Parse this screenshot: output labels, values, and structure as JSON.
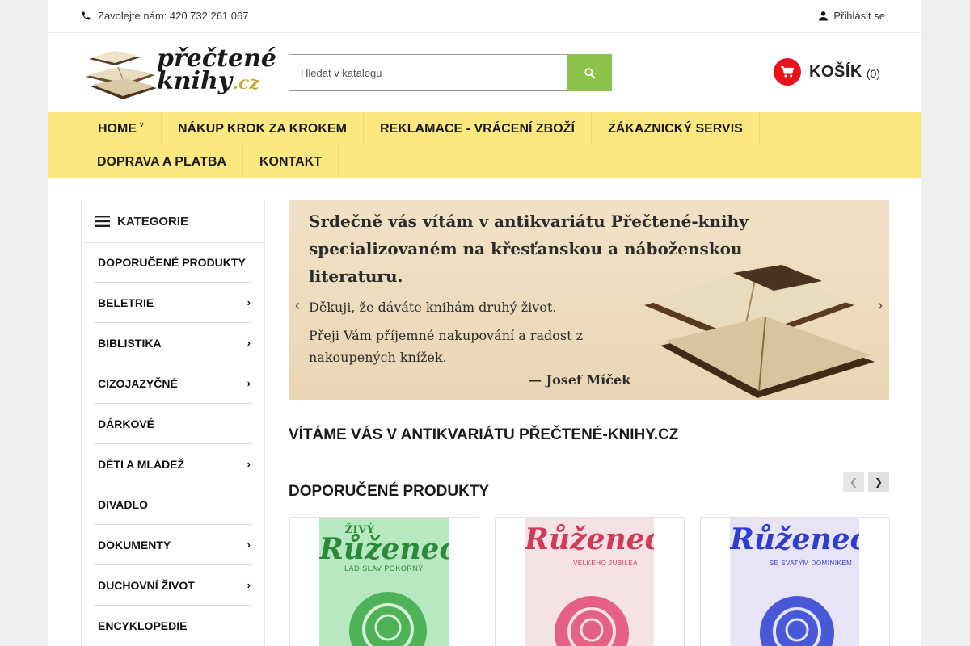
{
  "topbar": {
    "phone_text": "Zavolejte nám: 420 732 261 067",
    "login_text": "Přihlásit se"
  },
  "logo": {
    "line1": "přečtené",
    "line2": "knihy",
    "line3": ".cz"
  },
  "search": {
    "placeholder": "Hledat v katalogu"
  },
  "cart": {
    "label": "KOŠÍK",
    "count": "(0)"
  },
  "nav": {
    "items": [
      {
        "label": "HOME"
      },
      {
        "label": "NÁKUP KROK ZA KROKEM"
      },
      {
        "label": "REKLAMACE - VRÁCENÍ ZBOŽÍ"
      },
      {
        "label": "ZÁKAZNICKÝ SERVIS"
      },
      {
        "label": "DOPRAVA A PLATBA"
      },
      {
        "label": "KONTAKT"
      }
    ]
  },
  "sidebar": {
    "title": "KATEGORIE",
    "items": [
      {
        "label": "DOPORUČENÉ PRODUKTY",
        "has_children": false
      },
      {
        "label": "BELETRIE",
        "has_children": true
      },
      {
        "label": "BIBLISTIKA",
        "has_children": true
      },
      {
        "label": "CIZOJAZYČNÉ",
        "has_children": true
      },
      {
        "label": "DÁRKOVÉ",
        "has_children": false
      },
      {
        "label": "DĚTI A MLÁDEŽ",
        "has_children": true
      },
      {
        "label": "DIVADLO",
        "has_children": false
      },
      {
        "label": "DOKUMENTY",
        "has_children": true
      },
      {
        "label": "DUCHOVNÍ ŽIVOT",
        "has_children": true
      },
      {
        "label": "ENCYKLOPEDIE",
        "has_children": false
      }
    ]
  },
  "banner": {
    "line1": "Srdečně vás vítám v antikvariátu Přečtené-knihy",
    "line2": "specializovaném na křesťanskou a náboženskou",
    "line3": "literaturu.",
    "line4": "Děkuji, že dáváte knihám druhý život.",
    "line5": "Přeji Vám příjemné nakupování a radost z",
    "line6": "nakoupených knížek.",
    "signature": "— Josef Míček"
  },
  "main": {
    "welcome_heading": "VÍTÁME VÁS V ANTIKVARIÁTU PŘEČTENÉ-KNIHY.CZ",
    "products_heading": "DOPORUČENÉ PRODUKTY"
  },
  "products": [
    {
      "cover_top": "ŽIVÝ",
      "cover_title": "Růženec",
      "cover_sub": "LADISLAV POKORNÝ",
      "cover_color": "#b8e8c0",
      "rose_color": "#3aa845"
    },
    {
      "cover_title": "Růženec",
      "cover_sub": "VELKÉHO JUBILEA",
      "cover_color": "#f4e2e4",
      "rose_color": "#e24a73"
    },
    {
      "cover_title": "Růženec",
      "cover_sub": "SE SVATÝM DOMINIKEM",
      "cover_color": "#e9e3f6",
      "rose_color": "#2d3fd0"
    }
  ],
  "colors": {
    "nav_bg": "#fde87f",
    "search_button": "#8bc34a",
    "cart_icon_bg": "#e8131d"
  }
}
